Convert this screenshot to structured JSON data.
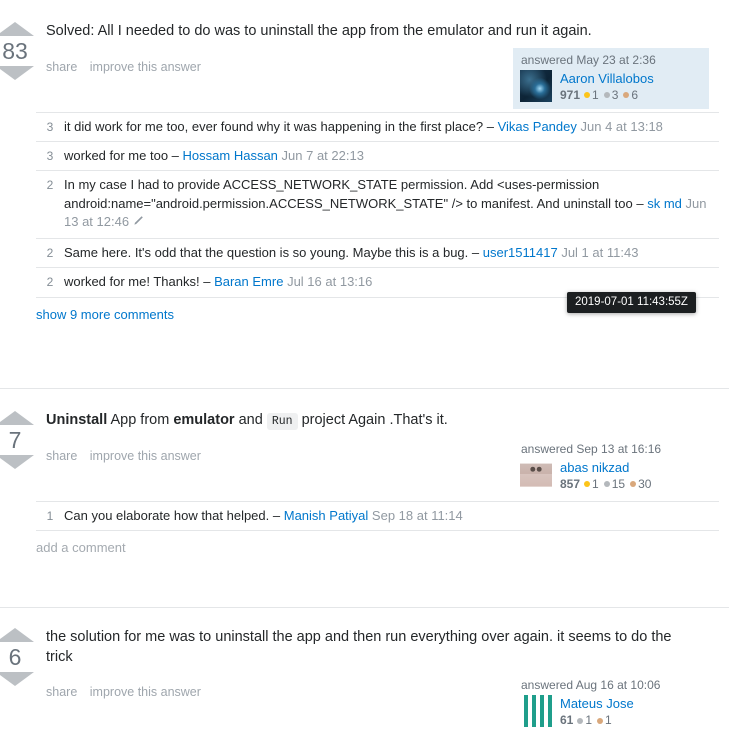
{
  "answers": [
    {
      "id": "answer-1",
      "vote_count": "83",
      "body_text": "Solved: All I needed to do was to uninstall the app from the emulator and run it again.",
      "share_label": "share",
      "improve_label": "improve this answer",
      "user": {
        "action_time": "answered May 23 at 2:36",
        "name": "Aaron Villalobos",
        "reputation": "971",
        "gold": "1",
        "silver": "3",
        "bronze": "6"
      },
      "comments": [
        {
          "score": "3",
          "text": "it did work for me too, ever found why it was happening in the first place?",
          "dash": "–",
          "user": "Vikas Pandey",
          "date": "Jun 4 at 13:18",
          "edited": false
        },
        {
          "score": "3",
          "text": "worked for me too",
          "dash": "–",
          "user": "Hossam Hassan",
          "date": "Jun 7 at 22:13",
          "edited": false
        },
        {
          "score": "2",
          "text": "In my case I had to provide ACCESS_NETWORK_STATE permission. Add <uses-permission android:name=\"android.permission.ACCESS_NETWORK_STATE\" /> to manifest. And uninstall too",
          "dash": "–",
          "user": "sk md",
          "date": "Jun 13 at 12:46",
          "edited": true
        },
        {
          "score": "2",
          "text": "Same here. It's odd that the question is so young. Maybe this is a bug.",
          "dash": "–",
          "user": "user1511417",
          "date": "Jul 1 at 11:43",
          "edited": false
        },
        {
          "score": "2",
          "text": "worked for me! Thanks!",
          "dash": "–",
          "user": "Baran Emre",
          "date": "Jul 16 at 13:16",
          "edited": false
        }
      ],
      "show_more_label": "show 9 more comments"
    },
    {
      "id": "answer-2",
      "vote_count": "7",
      "body_parts": {
        "bold1": "Uninstall",
        "mid1": " App from ",
        "bold2": "emulator",
        "mid2": " and ",
        "code": "Run",
        "tail": " project Again .That's it."
      },
      "share_label": "share",
      "improve_label": "improve this answer",
      "user": {
        "action_time": "answered Sep 13 at 16:16",
        "name": "abas nikzad",
        "reputation": "857",
        "gold": "1",
        "silver": "15",
        "bronze": "30"
      },
      "comments": [
        {
          "score": "1",
          "text": "Can you elaborate how that helped.",
          "dash": "–",
          "user": "Manish Patiyal",
          "date": "Sep 18 at 11:14",
          "edited": false
        }
      ],
      "add_comment_label": "add a comment"
    },
    {
      "id": "answer-3",
      "vote_count": "6",
      "body_text": "the solution for me was to uninstall the app and then run everything over again. it seems to do the trick",
      "share_label": "share",
      "improve_label": "improve this answer",
      "user": {
        "action_time": "answered Aug 16 at 10:06",
        "name": "Mateus Jose",
        "reputation": "61",
        "silver": "1",
        "bronze": "1"
      }
    }
  ],
  "tooltip": {
    "text": "2019-07-01 11:43:55Z"
  },
  "colors": {
    "link": "#0077cc",
    "muted": "#9fa6ad",
    "user_card_bg": "#e1ecf4",
    "gold": "#fcc419",
    "silver": "#b4b8bc",
    "bronze": "#d9a87c",
    "tooltip_bg": "#1c1f21"
  }
}
